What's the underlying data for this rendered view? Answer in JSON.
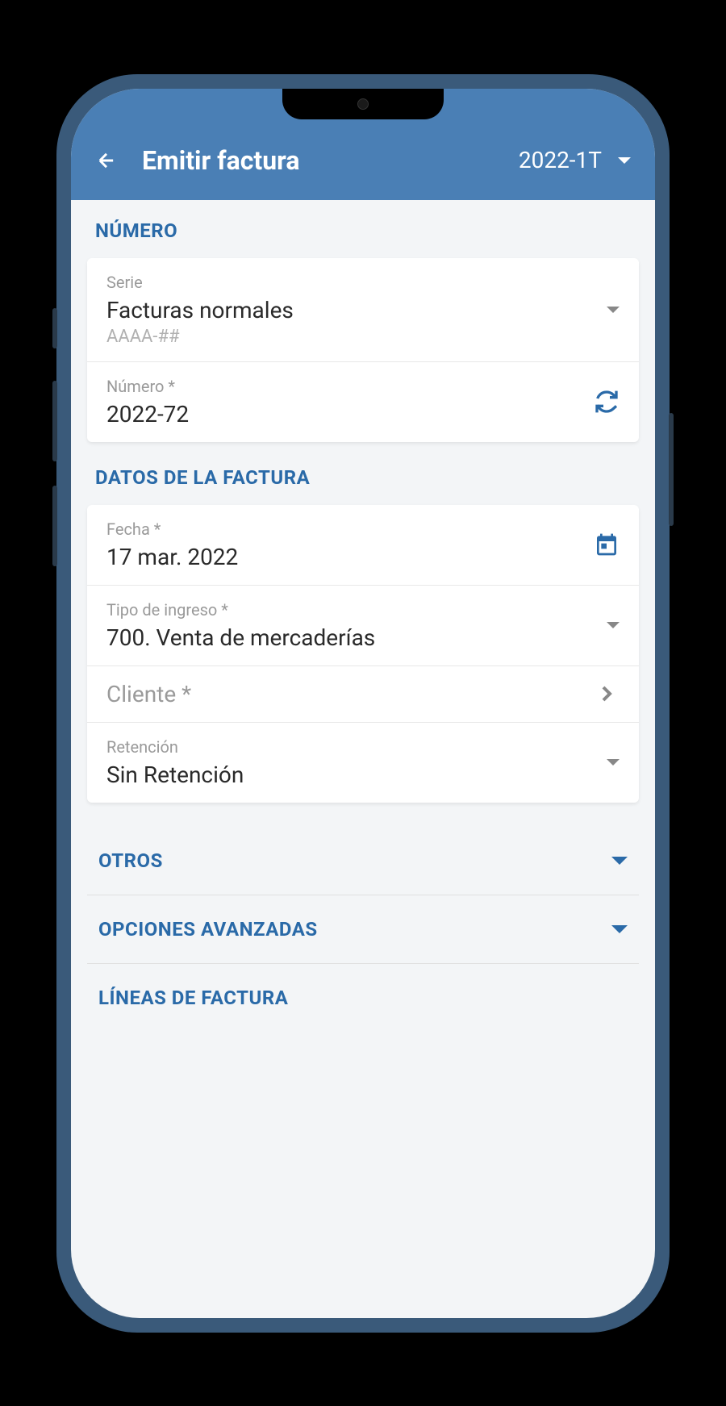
{
  "header": {
    "title": "Emitir factura",
    "period": "2022-1T"
  },
  "sections": {
    "number": {
      "label": "NÚMERO",
      "serie": {
        "label": "Serie",
        "value": "Facturas normales",
        "format": "AAAA-##"
      },
      "numero": {
        "label": "Número *",
        "value": "2022-72"
      }
    },
    "invoiceData": {
      "label": "DATOS DE LA FACTURA",
      "fecha": {
        "label": "Fecha *",
        "value": "17 mar. 2022"
      },
      "tipo": {
        "label": "Tipo de ingreso *",
        "value": "700. Venta de mercaderías"
      },
      "cliente": {
        "label": "Cliente *",
        "value": ""
      },
      "retencion": {
        "label": "Retención",
        "value": "Sin Retención"
      }
    },
    "otros": {
      "label": "OTROS"
    },
    "avanzadas": {
      "label": "OPCIONES AVANZADAS"
    },
    "lineas": {
      "label": "LÍNEAS DE FACTURA"
    }
  }
}
